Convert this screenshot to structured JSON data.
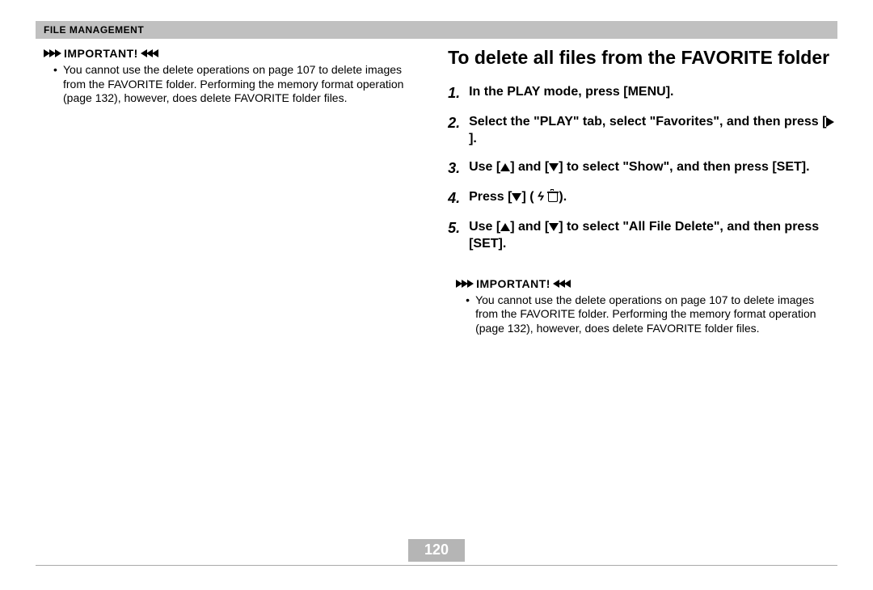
{
  "header": {
    "title": "File Management"
  },
  "left": {
    "important_label": "IMPORTANT!",
    "bullet": "You cannot use the delete operations on page 107 to delete images from the FAVORITE folder. Performing the memory format operation (page 132), however, does delete FAVORITE folder files."
  },
  "right": {
    "title": "To delete all files from the FAVORITE folder",
    "steps": {
      "s1": "In the PLAY mode, press [MENU].",
      "s2_a": "Select the \"PLAY\" tab, select \"Favorites\", and then press [",
      "s2_b": "].",
      "s3_a": "Use [",
      "s3_b": "] and [",
      "s3_c": "] to select \"Show\", and then press [SET].",
      "s4_a": "Press [",
      "s4_b": "] (",
      "s4_c": ").",
      "s5_a": "Use [",
      "s5_b": "] and [",
      "s5_c": "] to select \"All File Delete\", and then press [SET]."
    },
    "important_label": "IMPORTANT!",
    "bullet": "You cannot use the delete operations on page 107 to delete images from the FAVORITE folder. Performing the memory format operation (page 132), however, does delete FAVORITE folder files."
  },
  "page_number": "120"
}
